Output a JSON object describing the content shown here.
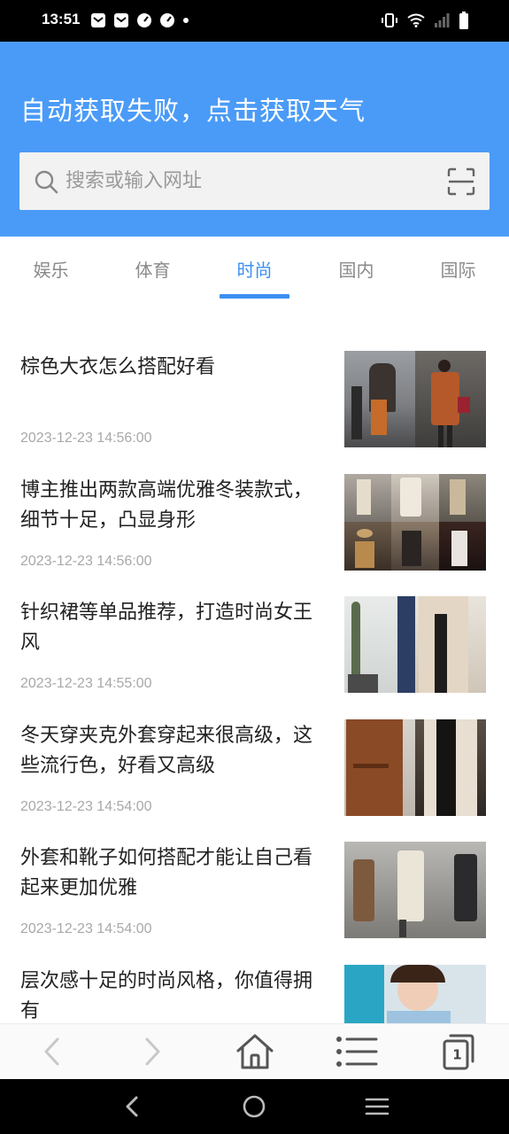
{
  "status_bar": {
    "time": "13:51",
    "notification_icons": [
      "mail-icon",
      "mail-icon",
      "speedometer-icon",
      "speedometer-icon",
      "dot-icon"
    ],
    "right_icons": [
      "vibrate-icon",
      "wifi-icon",
      "signal-icon",
      "battery-icon"
    ]
  },
  "header": {
    "weather_text": "自动获取失败，点击获取天气",
    "bg_color": "#4a9bf7"
  },
  "search": {
    "placeholder": "搜索或输入网址",
    "value": ""
  },
  "tabs": [
    {
      "label": "娱乐",
      "active": false
    },
    {
      "label": "体育",
      "active": false
    },
    {
      "label": "时尚",
      "active": true
    },
    {
      "label": "国内",
      "active": false
    },
    {
      "label": "国际",
      "active": false
    }
  ],
  "accent_color": "#3d8ff1",
  "news": [
    {
      "title": "棕色大衣怎么搭配好看",
      "time": "2023-12-23 14:56:00"
    },
    {
      "title": "博主推出两款高端优雅冬装款式，细节十足，凸显身形",
      "time": "2023-12-23 14:56:00"
    },
    {
      "title": "针织裙等单品推荐，打造时尚女王风",
      "time": "2023-12-23 14:55:00"
    },
    {
      "title": "冬天穿夹克外套穿起来很高级，这些流行色，好看又高级",
      "time": "2023-12-23 14:54:00"
    },
    {
      "title": "外套和靴子如何搭配才能让自己看起来更加优雅",
      "time": "2023-12-23 14:54:00"
    },
    {
      "title": "层次感十足的时尚风格，你值得拥有",
      "time": ""
    }
  ],
  "toolbar": {
    "tab_count": "1",
    "icons": [
      "back-icon",
      "forward-icon",
      "home-icon",
      "menu-list-icon",
      "tabs-icon"
    ]
  },
  "system_nav": {
    "icons": [
      "nav-back-icon",
      "nav-home-icon",
      "nav-recents-icon"
    ]
  }
}
